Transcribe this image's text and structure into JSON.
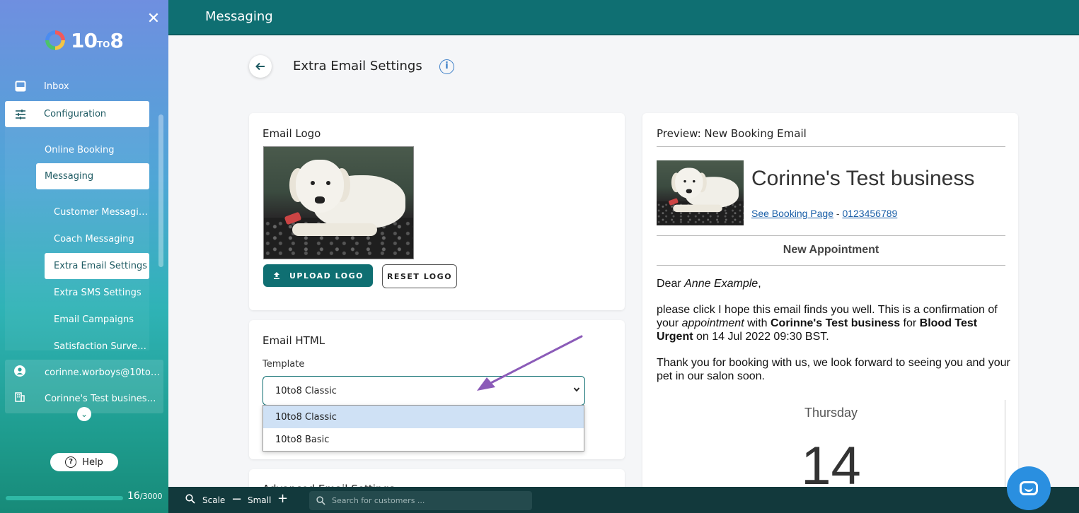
{
  "app": {
    "logo_text": "10",
    "logo_small": "TO",
    "logo_end": "8",
    "close_icon": "close-icon"
  },
  "sidebar": {
    "inbox": "Inbox",
    "configuration": "Configuration",
    "online_booking": "Online Booking",
    "messaging": "Messaging",
    "sub_items": [
      "Customer Messagi…",
      "Coach Messaging",
      "Extra Email Settings",
      "Extra SMS Settings",
      "Email Campaigns",
      "Satisfaction Surve…"
    ],
    "user_email": "corinne.worboys@10to…",
    "business": "Corinne's Test busines…",
    "help": "Help",
    "credits_used": "16",
    "credits_total": "/3000",
    "credits_fraction": 0.005
  },
  "header": {
    "title": "Messaging"
  },
  "page": {
    "title": "Extra Email Settings"
  },
  "email_logo": {
    "title": "Email Logo",
    "upload_label": "UPLOAD LOGO",
    "reset_label": "RESET LOGO"
  },
  "email_html": {
    "title": "Email HTML",
    "template_label": "Template",
    "selected": "10to8 Classic",
    "options": [
      "10to8 Classic",
      "10to8 Basic"
    ],
    "next_section_partial": "Advanced Email Settings"
  },
  "preview": {
    "title": "Preview: New Booking Email",
    "business_name": "Corinne's Test business",
    "booking_link": "See Booking Page",
    "separator": " - ",
    "phone": "0123456789",
    "section_heading": "New Appointment",
    "dear": "Dear ",
    "customer": "Anne Example",
    "comma": ",",
    "p1_a": "please click I hope this email finds you well. This is a confirmation of your ",
    "p1_b": "appointment",
    "p1_c": " with ",
    "p1_d": "Corinne's Test business",
    "p1_e": " for ",
    "p1_f": "Blood Test Urgent",
    "p1_g": " on 14 Jul 2022 09:30 BST.",
    "p2": "Thank you for booking with us, we look forward to seeing you and your pet in our salon soon.",
    "day_name": "Thursday",
    "day_number": "14"
  },
  "bottom_bar": {
    "scale_label": "Scale",
    "scale_value": "Small",
    "search_placeholder": "Search for customers ..."
  },
  "colors": {
    "primary": "#0f6f72",
    "link": "#1a5fa8",
    "arrow": "#8b5bb8",
    "chat": "#2a8fe0"
  }
}
